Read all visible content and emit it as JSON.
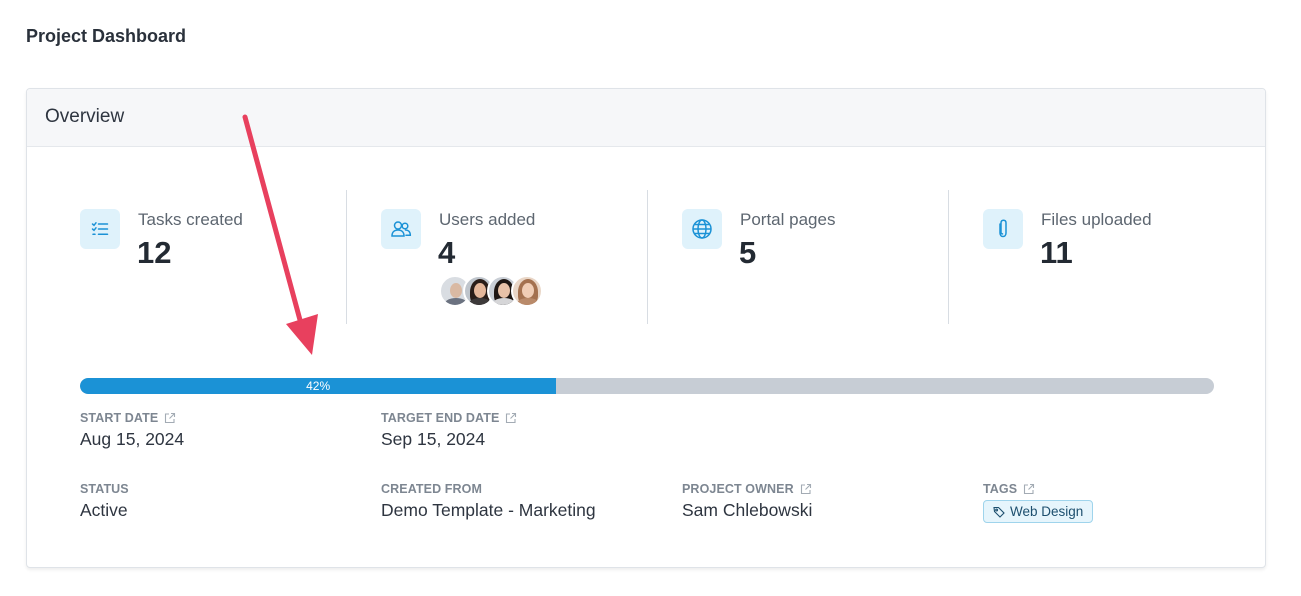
{
  "page": {
    "title": "Project Dashboard"
  },
  "overview": {
    "header": "Overview",
    "stats": [
      {
        "label": "Tasks created",
        "value": "12",
        "icon": "task-list-icon"
      },
      {
        "label": "Users added",
        "value": "4",
        "icon": "users-icon"
      },
      {
        "label": "Portal pages",
        "value": "5",
        "icon": "globe-icon"
      },
      {
        "label": "Files uploaded",
        "value": "11",
        "icon": "paperclip-icon"
      }
    ],
    "progress": {
      "value": 0.42,
      "label": "42%"
    },
    "fields": {
      "start_date": {
        "label": "START DATE",
        "value": "Aug 15, 2024"
      },
      "target_end_date": {
        "label": "TARGET END DATE",
        "value": "Sep 15, 2024"
      },
      "status": {
        "label": "STATUS",
        "value": "Active"
      },
      "created_from": {
        "label": "CREATED FROM",
        "value": "Demo Template - Marketing"
      },
      "project_owner": {
        "label": "PROJECT OWNER",
        "value": "Sam Chlebowski"
      },
      "tags": {
        "label": "TAGS",
        "items": [
          "Web Design"
        ]
      }
    }
  },
  "colors": {
    "accent": "#1b92d6",
    "icon_bg": "#dff2fb",
    "annotation_arrow": "#e8405e"
  }
}
